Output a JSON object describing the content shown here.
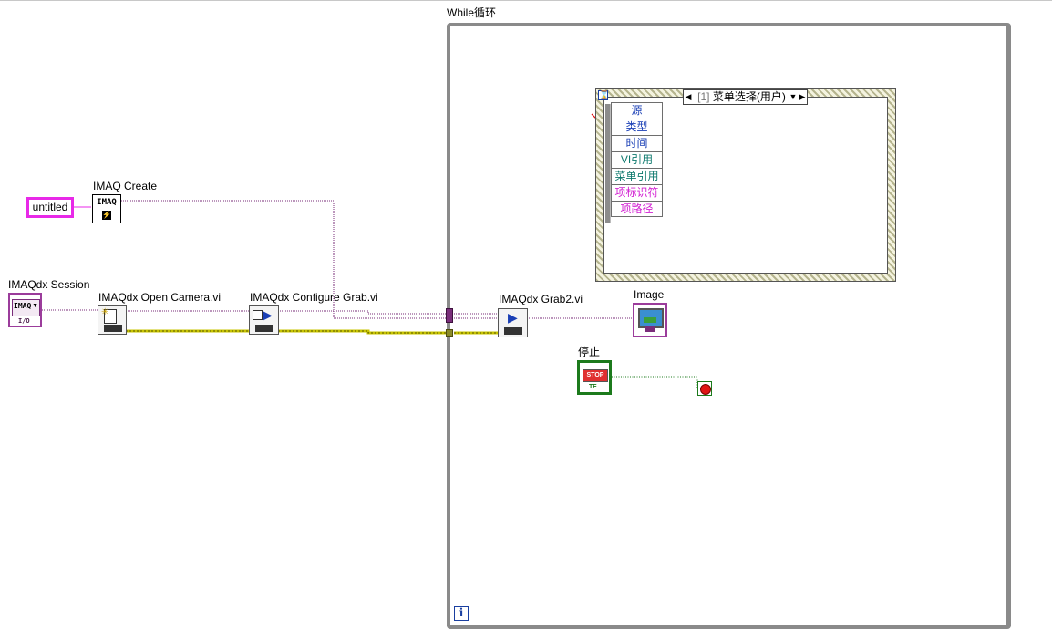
{
  "labels": {
    "while_loop": "While循环",
    "imaq_create": "IMAQ Create",
    "untitled_const": "untitled",
    "imaqdx_session": "IMAQdx Session",
    "open_camera": "IMAQdx Open Camera.vi",
    "configure_grab": "IMAQdx Configure Grab.vi",
    "grab2": "IMAQdx Grab2.vi",
    "image": "Image",
    "stop": "停止"
  },
  "event_structure": {
    "case_index": "[1]",
    "case_name": "菜单选择(用户)",
    "data_items": [
      {
        "label": "源",
        "color": "#1a3fb5"
      },
      {
        "label": "类型",
        "color": "#1a3fb5"
      },
      {
        "label": "时间",
        "color": "#1a3fb5"
      },
      {
        "label": "VI引用",
        "color": "#0f7a6e"
      },
      {
        "label": "菜单引用",
        "color": "#0f7a6e"
      },
      {
        "label": "项标识符",
        "color": "#d21fd2"
      },
      {
        "label": "项路径",
        "color": "#d21fd2"
      }
    ]
  },
  "icons": {
    "imaq_create_text": "IMAQ",
    "session_text": "IMAQ",
    "session_io": "I/O",
    "stop_text": "STOP",
    "tf_text": "TF",
    "iteration_text": "i",
    "timeout_text": "⌛"
  },
  "colors": {
    "wire_image": "#7a2d7a",
    "wire_error": "#c8c400",
    "string_const": "#e829e8",
    "boolean_green": "#1c7a1c"
  }
}
